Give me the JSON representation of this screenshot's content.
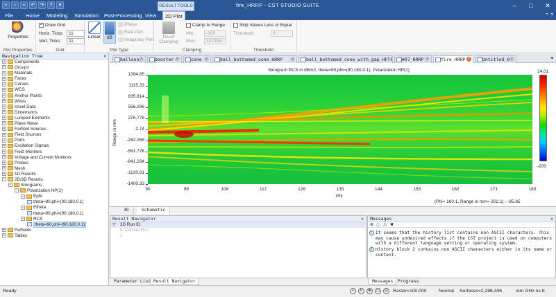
{
  "window": {
    "title": "fire_HRRP - CST STUDIO SUITE"
  },
  "ribbon": {
    "tabs": [
      "File",
      "Home",
      "Modeling",
      "Simulation",
      "Post-Processing",
      "View",
      "2D Plot"
    ],
    "context_tab": "RESULT TOOLS",
    "properties_label": "Properties",
    "plot_properties_label": "Plot Properties",
    "grid_label": "Grid",
    "draw_grid_label": "Draw Grid",
    "horiz_ticks_label": "Horiz. Ticks:",
    "horiz_ticks_value": "11",
    "vert_ticks_label": "Vert. Ticks:",
    "vert_ticks_value": "11",
    "linear_label": "Linear",
    "db_label": "dB",
    "phase_label": "Phase",
    "real_part_label": "Real Part",
    "imag_part_label": "Imaginary Part",
    "plot_type_label": "Plot Type",
    "reset_clamping_label": "Reset Clamping",
    "clamp_to_range_label": "Clamp to Range",
    "min_label": "Min:",
    "min_value": "-200",
    "max_label": "Max:",
    "max_value": "14.0054",
    "clamping_label": "Clamping",
    "skip_values_label": "Skip Values Less or Equal",
    "threshold_label": "Threshold:",
    "threshold_value": "0",
    "threshold_group_label": "Threshold"
  },
  "navigation_tree": {
    "title": "Navigation Tree",
    "items": [
      {
        "label": "Components",
        "level": 0
      },
      {
        "label": "Groups",
        "level": 0
      },
      {
        "label": "Materials",
        "level": 0
      },
      {
        "label": "Faces",
        "level": 0
      },
      {
        "label": "Curves",
        "level": 0
      },
      {
        "label": "WCS",
        "level": 0
      },
      {
        "label": "Anchor Points",
        "level": 0
      },
      {
        "label": "Wires",
        "level": 0
      },
      {
        "label": "Voxel Data",
        "level": 0
      },
      {
        "label": "Dimensions",
        "level": 0
      },
      {
        "label": "Lumped Elements",
        "level": 0
      },
      {
        "label": "Plane Wave",
        "level": 0
      },
      {
        "label": "Farfield Sources",
        "level": 0
      },
      {
        "label": "Field Sources",
        "level": 0
      },
      {
        "label": "Ports",
        "level": 0
      },
      {
        "label": "Excitation Signals",
        "level": 0
      },
      {
        "label": "Field Monitors",
        "level": 0
      },
      {
        "label": "Voltage and Current Monitors",
        "level": 0
      },
      {
        "label": "Probes",
        "level": 0
      },
      {
        "label": "Mesh",
        "level": 0
      },
      {
        "label": "1D Results",
        "level": 0
      },
      {
        "label": "2D/3D Results",
        "level": 0
      },
      {
        "label": "Sinograms",
        "level": 1
      },
      {
        "label": "Polarization HP(1)",
        "level": 2
      },
      {
        "label": "Ephi",
        "level": 3
      },
      {
        "label": "theta=90,phi=(90,180,0.1)",
        "level": 4
      },
      {
        "label": "Etheta",
        "level": 3
      },
      {
        "label": "theta=90,phi=(90,180,0.1)",
        "level": 4
      },
      {
        "label": "RCS",
        "level": 3
      },
      {
        "label": "theta=90,phi=(90,180,0.1)",
        "level": 4
      },
      {
        "label": "Farfields",
        "level": 0
      },
      {
        "label": "Tables",
        "level": 0
      }
    ]
  },
  "doc_tabs": [
    "balloon",
    "booster",
    "cone",
    "ball_bottomed_cone_HRRP",
    "ball_bottomed_cone_with_gap_HRRP",
    "#97_HRRP",
    "fire_HRRP",
    "Untitled_0"
  ],
  "chart_data": {
    "type": "heatmap",
    "title": "Sinogram RCS in dBm2, theta=90,phi=(90,180,0.1), Polarization HP(1)",
    "xlabel": "Phi",
    "ylabel": "Range in mm",
    "x_ticks": [
      "90",
      "99",
      "108",
      "117",
      "126",
      "135",
      "144",
      "153",
      "162",
      "171",
      "180"
    ],
    "y_ticks": [
      "1394.85",
      "1115.33",
      "835.814",
      "556.296",
      "276.778",
      "-2.74",
      "-282.258",
      "-561.776",
      "-841.294",
      "-1120.81",
      "-1400.33"
    ],
    "xlim": [
      90,
      180
    ],
    "ylim": [
      -1400.33,
      1394.85
    ],
    "colorbar": {
      "max": "14.01",
      "min": "-200"
    },
    "readout": "(Phi=      160.1, Range in mm=    302.1) :  -95.85"
  },
  "view_tabs": [
    "3D",
    "Schematic"
  ],
  "result_navigator": {
    "title": "Result Navigator",
    "header": "3D Run ID",
    "rows": [
      "0: Current Run",
      "1"
    ]
  },
  "messages": {
    "title": "Messages",
    "items": [
      "It seems that the history list contains non ASCII characters. This may cause undesired effects if the CST project is used on computers with a different language setting or operating system.",
      "History block 2 contains non ASCII characters either in its name or content."
    ]
  },
  "bottom_tabs_left": [
    "Parameter List",
    "Result Navigator"
  ],
  "bottom_tabs_right": [
    "Messages",
    "Progress"
  ],
  "statusbar": {
    "ready": "Ready",
    "raster": "Raster=100.000",
    "mode": "Normal",
    "surfaces": "Surfaces=2,286,406",
    "units": "mm  GHz  ns  K"
  }
}
